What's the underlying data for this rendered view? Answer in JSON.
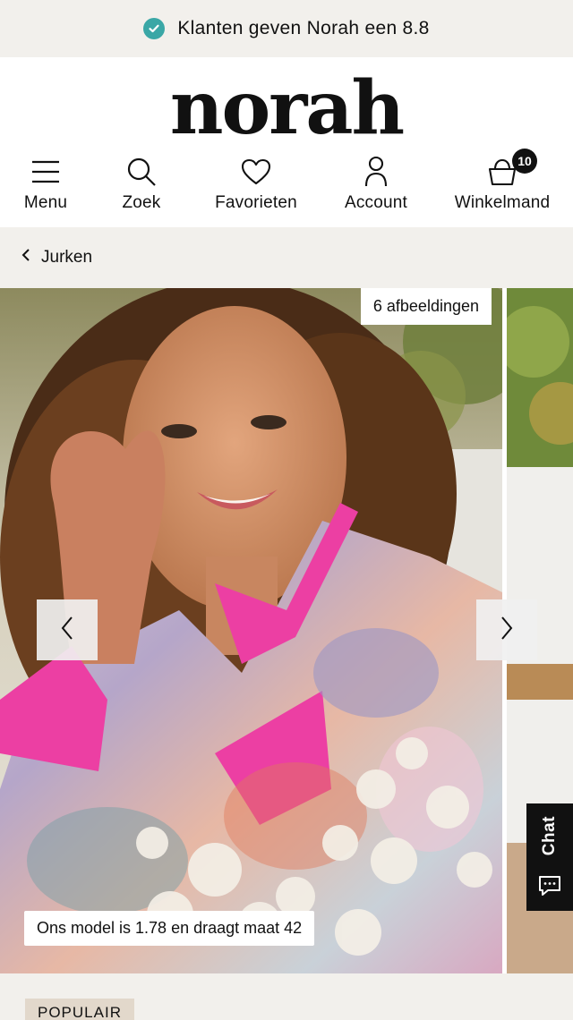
{
  "topbar": {
    "rating_text": "Klanten geven Norah een 8.8",
    "icon": "check-circle-icon",
    "icon_color": "#3aa7a6"
  },
  "header": {
    "logo": "norah",
    "nav": [
      {
        "label": "Menu",
        "icon": "hamburger-icon"
      },
      {
        "label": "Zoek",
        "icon": "search-icon"
      },
      {
        "label": "Favorieten",
        "icon": "heart-icon"
      },
      {
        "label": "Account",
        "icon": "user-icon"
      },
      {
        "label": "Winkelmand",
        "icon": "basket-icon",
        "badge": "10"
      }
    ]
  },
  "breadcrumb": {
    "label": "Jurken",
    "icon": "chevron-left-icon"
  },
  "gallery": {
    "image_count": "6 afbeeldingen",
    "model_note": "Ons model is 1.78 en draagt maat 42",
    "prev_icon": "chevron-left-icon",
    "next_icon": "chevron-right-icon"
  },
  "chat": {
    "label": "Chat",
    "icon": "chat-bubble-icon"
  },
  "tag": {
    "label": "POPULAIR"
  },
  "colors": {
    "background": "#f2f0ec",
    "accent_pink": "#ec3fa3",
    "tag_bg": "#e2d8cb"
  }
}
